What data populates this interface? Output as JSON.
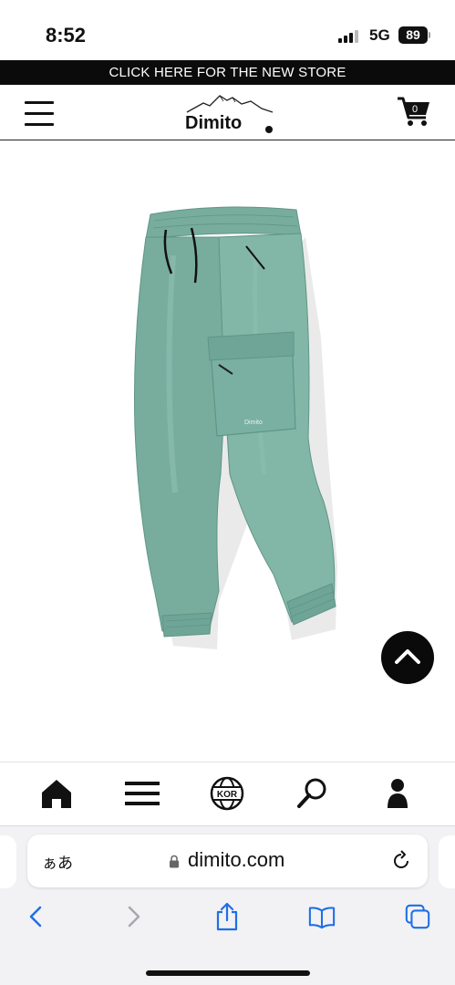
{
  "status_bar": {
    "time": "8:52",
    "network": "5G",
    "battery": "89"
  },
  "announcement": {
    "text": "CLICK HERE FOR THE NEW STORE"
  },
  "header": {
    "logo_text": "Dimito",
    "cart_count": "0",
    "icons": [
      "menu-icon",
      "cart-icon"
    ]
  },
  "product": {
    "colors": {
      "garment": "#78ad9e",
      "garment_shade": "#5f9585",
      "garment_highlight": "#8fc0b2"
    }
  },
  "site_nav": {
    "items": [
      {
        "icon": "home-icon"
      },
      {
        "icon": "menu-icon"
      },
      {
        "icon": "globe-icon",
        "label": "KOR"
      },
      {
        "icon": "search-icon"
      },
      {
        "icon": "user-icon"
      }
    ]
  },
  "browser": {
    "aa_label": "ぁあ",
    "url": "dimito.com",
    "toolbar_icons": [
      "back-icon",
      "forward-icon",
      "share-icon",
      "bookmarks-icon",
      "tabs-icon"
    ]
  },
  "theme": {
    "bar_black": "#0b0b0b",
    "ios_blue": "#1f6fe6",
    "ios_disabled": "#a7a7ad"
  }
}
